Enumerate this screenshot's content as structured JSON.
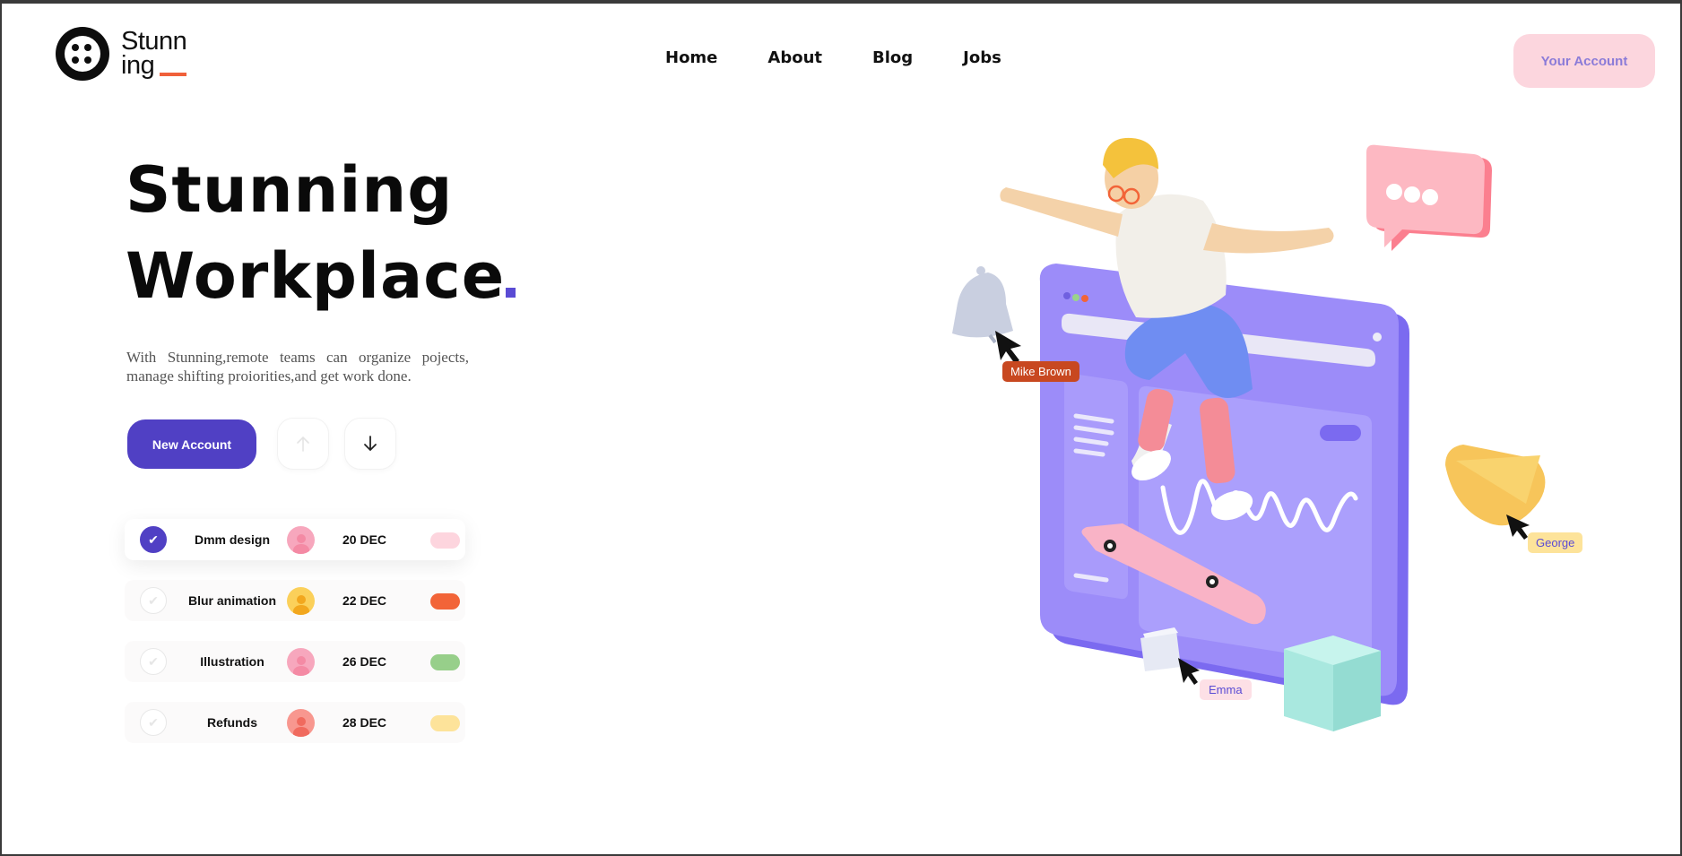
{
  "brand": {
    "line1": "Stunn",
    "line2": "ing"
  },
  "nav": [
    {
      "label": "Home"
    },
    {
      "label": "About"
    },
    {
      "label": "Blog"
    },
    {
      "label": "Jobs"
    }
  ],
  "account_button": "Your Account",
  "hero": {
    "title_line1": "Stunning",
    "title_line2": "Workplace",
    "description": "With Stunning,remote teams can organize pojects, manage shifting proiorities,and get work done."
  },
  "cta": {
    "new_account": "New Account"
  },
  "tasks": [
    {
      "name": "Dmm design",
      "date": "20 DEC",
      "done": true,
      "avatar_color": "#f7a7bd",
      "tag_color": "#fdd5de"
    },
    {
      "name": "Blur animation",
      "date": "22 DEC",
      "done": false,
      "avatar_color": "#fbd05a",
      "tag_color": "#f26438"
    },
    {
      "name": "Illustration",
      "date": "26 DEC",
      "done": false,
      "avatar_color": "#f7a7bd",
      "tag_color": "#97cf8a"
    },
    {
      "name": "Refunds",
      "date": "28 DEC",
      "done": false,
      "avatar_color": "#f8978f",
      "tag_color": "#fde39a"
    }
  ],
  "illustration": {
    "labels": {
      "mike": "Mike Brown",
      "george": "George",
      "emma": "Emma"
    }
  },
  "colors": {
    "brand_accent": "#5040c4",
    "logo_underline": "#f0603a",
    "account_bg": "#fcd6de"
  }
}
